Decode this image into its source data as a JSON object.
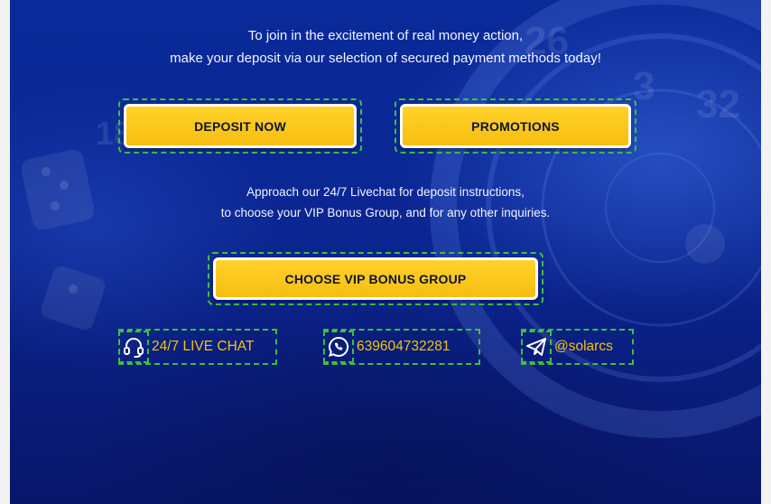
{
  "intro": {
    "line1": "To join in the excitement of real money action,",
    "line2": "make your deposit via our selection of secured payment methods today!"
  },
  "buttons": {
    "deposit": "DEPOSIT NOW",
    "promotions": "PROMOTIONS",
    "vip": "CHOOSE VIP BONUS GROUP"
  },
  "info": {
    "line1": "Approach our 24/7 Livechat for deposit instructions,",
    "line2": "to choose your VIP Bonus Group, and for any other inquiries."
  },
  "contacts": [
    {
      "icon": "headset-icon",
      "label": "24/7 LIVE CHAT"
    },
    {
      "icon": "whatsapp-icon",
      "label": "639604732281"
    },
    {
      "icon": "telegram-icon",
      "label": "@solarcs"
    }
  ],
  "colors": {
    "background": "#0b2692",
    "button": "#f7bd10",
    "accent_text": "#f4c20d",
    "outline": "#3fbf3f"
  }
}
